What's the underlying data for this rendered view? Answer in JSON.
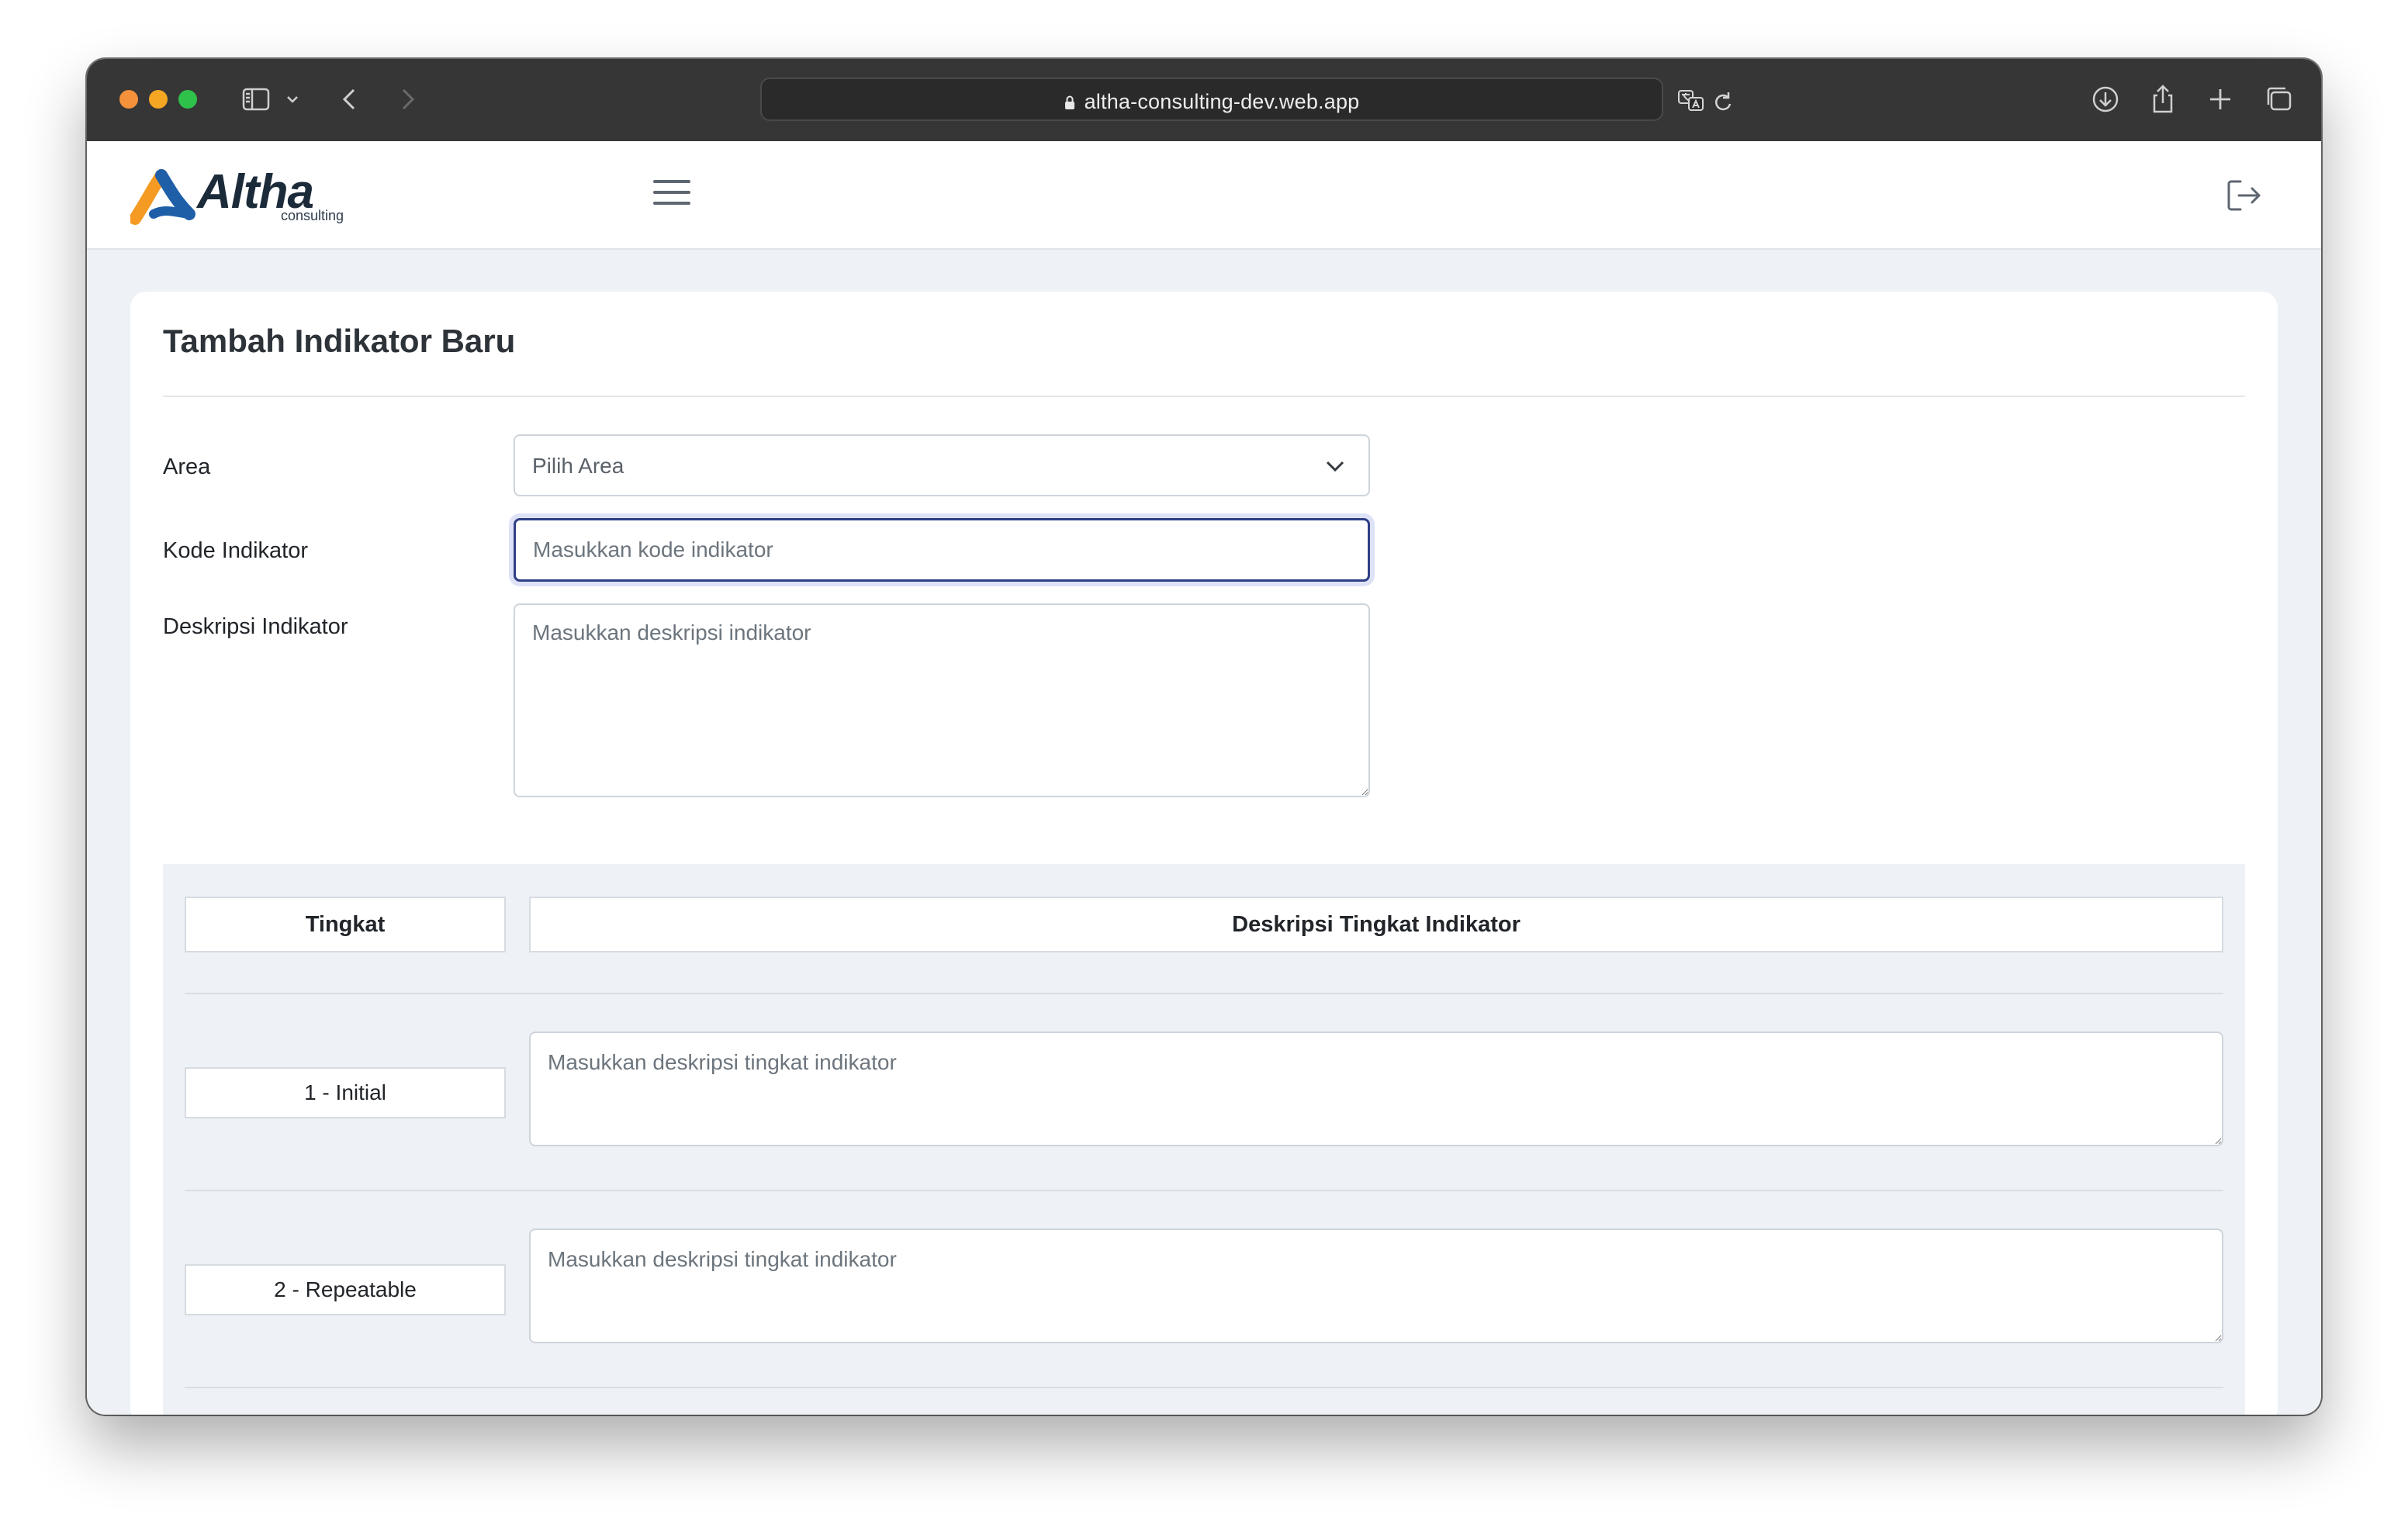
{
  "browser": {
    "url": "altha-consulting-dev.web.app",
    "icons": [
      "sidebar-icon",
      "chevron-down-icon",
      "back-icon",
      "forward-icon",
      "lock-icon",
      "translate-icon",
      "reload-icon",
      "download-icon",
      "share-icon",
      "new-tab-icon",
      "tabs-overview-icon"
    ]
  },
  "header": {
    "logo_word": "Altha",
    "logo_sub": "consulting",
    "icons": [
      "menu-icon",
      "logout-icon"
    ]
  },
  "form": {
    "title": "Tambah Indikator Baru",
    "area_label": "Area",
    "area_value": "Pilih Area",
    "kode_label": "Kode Indikator",
    "kode_placeholder": "Masukkan kode indikator",
    "deskripsi_label": "Deskripsi Indikator",
    "deskripsi_placeholder": "Masukkan deskripsi indikator"
  },
  "levels": {
    "col_tingkat": "Tingkat",
    "col_deskripsi": "Deskripsi Tingkat Indikator",
    "rows": [
      {
        "label": "1 - Initial",
        "placeholder": "Masukkan deskripsi tingkat indikator"
      },
      {
        "label": "2 - Repeatable",
        "placeholder": "Masukkan deskripsi tingkat indikator"
      }
    ]
  },
  "colors": {
    "titlebar": "#363636",
    "page_bg": "#eef1f5",
    "focus_border": "#2f3f86",
    "logo_blue": "#1f5fa8",
    "logo_orange": "#f59a23"
  }
}
